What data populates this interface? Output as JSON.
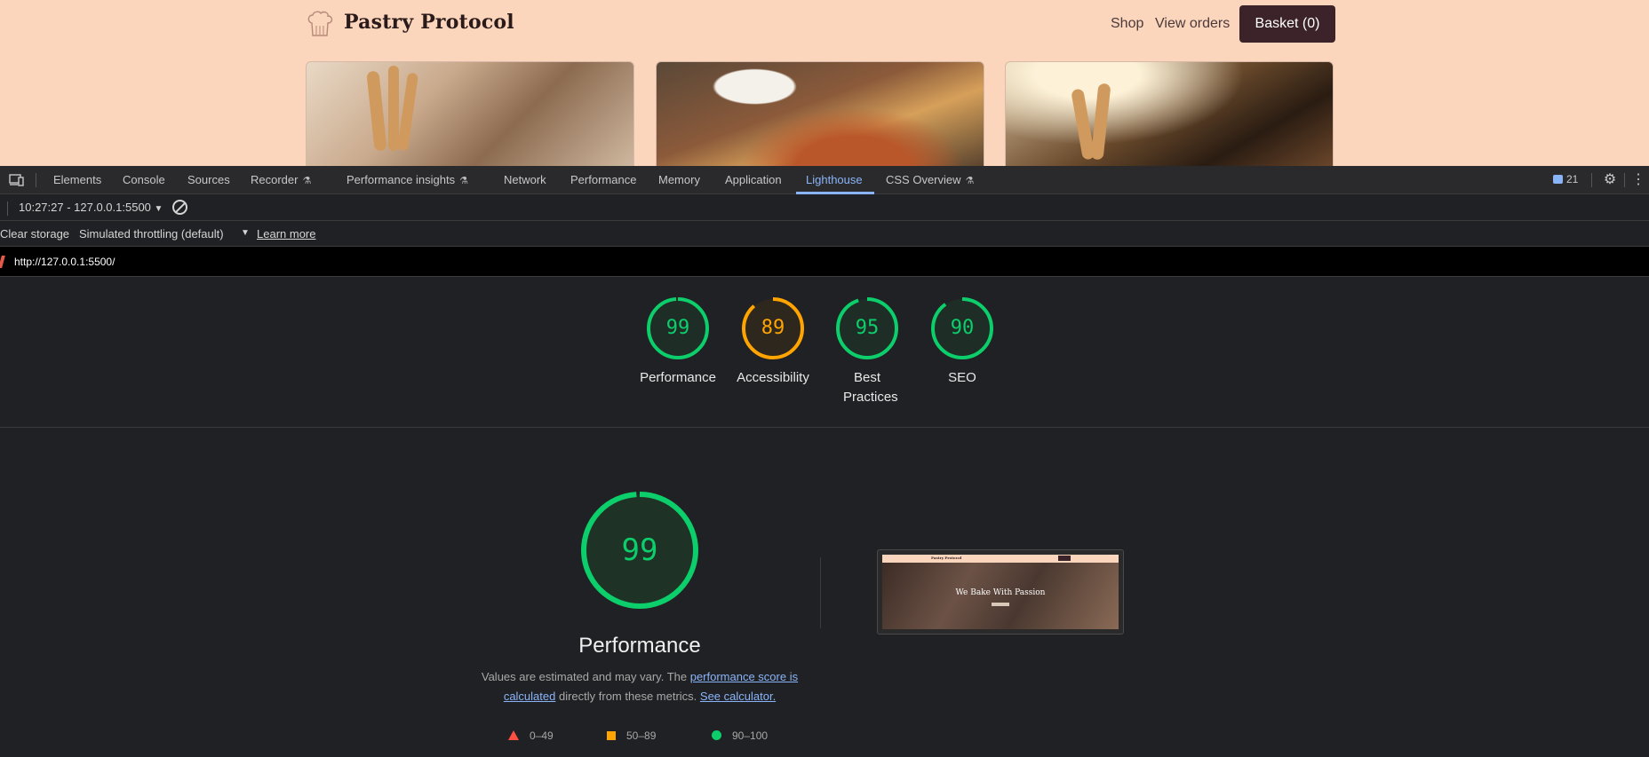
{
  "site": {
    "title": "Pastry Protocol",
    "nav": {
      "shop": "Shop",
      "orders": "View orders"
    },
    "basket_label": "Basket (0)",
    "colors": {
      "background": "#fcd5bd",
      "button": "#3b2329"
    }
  },
  "devtools": {
    "tabs": [
      {
        "label": "Elements"
      },
      {
        "label": "Console"
      },
      {
        "label": "Sources"
      },
      {
        "label": "Recorder"
      },
      {
        "label": "Performance insights"
      },
      {
        "label": "Network"
      },
      {
        "label": "Performance"
      },
      {
        "label": "Memory"
      },
      {
        "label": "Application"
      },
      {
        "label": "Lighthouse"
      },
      {
        "label": "CSS Overview"
      }
    ],
    "active_tab": "Lighthouse",
    "issues_count": "21",
    "report_select": "10:27:27 - 127.0.0.1:5500",
    "toolbar": {
      "clear_storage": "Clear storage",
      "throttling": "Simulated throttling (default)",
      "learn_more": "Learn more"
    },
    "url": "http://127.0.0.1:5500/"
  },
  "lighthouse": {
    "scores": [
      {
        "label": "Performance",
        "value": "99",
        "status": "pass"
      },
      {
        "label": "Accessibility",
        "value": "89",
        "status": "average"
      },
      {
        "label": "Best Practices",
        "value": "95",
        "status": "pass"
      },
      {
        "label": "SEO",
        "value": "90",
        "status": "pass"
      }
    ],
    "main": {
      "value": "99",
      "title": "Performance",
      "desc_prefix": "Values are estimated and may vary. The ",
      "desc_link1": "performance score is calculated",
      "desc_middle": " directly from these metrics. ",
      "desc_link2": "See calculator."
    },
    "screenshot": {
      "headline": "We Bake With Passion",
      "logo": "Pastry Protocol"
    },
    "legend": [
      {
        "shape": "triangle",
        "range": "0–49",
        "color": "#ff4e42"
      },
      {
        "shape": "square",
        "range": "50–89",
        "color": "#ffa400"
      },
      {
        "shape": "circle",
        "range": "90–100",
        "color": "#0cce6b"
      }
    ],
    "colors": {
      "pass": "#0cce6b",
      "average": "#ffa400",
      "fail": "#ff4e42"
    }
  }
}
